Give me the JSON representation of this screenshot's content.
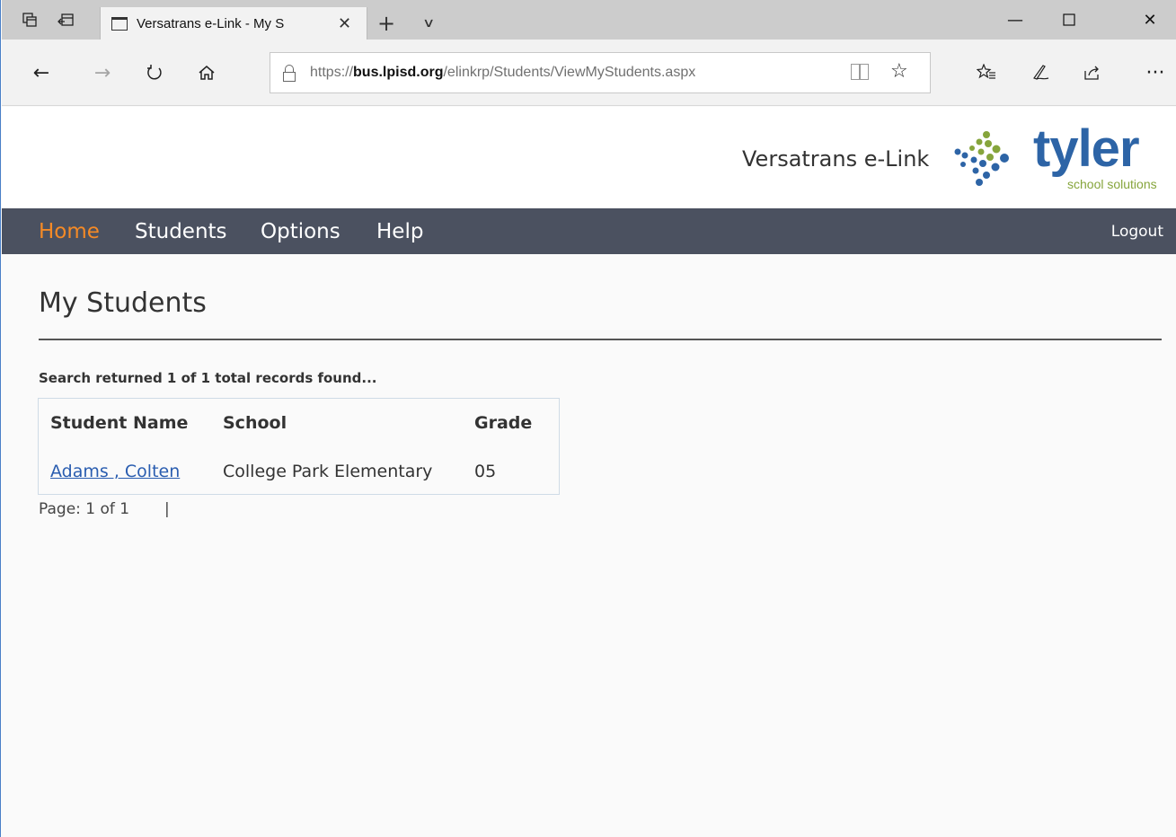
{
  "browser": {
    "tab_title": "Versatrans e-Link - My S",
    "url_prefix": "https://",
    "url_domain": "bus.lpisd.org",
    "url_path": "/elinkrp/Students/ViewMyStudents.aspx"
  },
  "site": {
    "brand": "Versatrans e-Link",
    "logo_text": "tyler",
    "logo_sub": "school solutions",
    "colors": {
      "logo_blue": "#2d64a6",
      "logo_green": "#86a53c",
      "menu_bg": "#4b5160",
      "menu_active": "#f58a26"
    }
  },
  "menu": {
    "items": [
      {
        "label": "Home",
        "active": true
      },
      {
        "label": "Students",
        "active": false
      },
      {
        "label": "Options",
        "active": false
      },
      {
        "label": "Help",
        "active": false
      }
    ],
    "logout": "Logout"
  },
  "main": {
    "title": "My Students",
    "record_info": "Search returned 1 of 1 total records found...",
    "table": {
      "headers": [
        "Student Name",
        "School",
        "Grade"
      ],
      "rows": [
        [
          "Adams , Colten",
          "College Park Elementary",
          "05"
        ]
      ]
    },
    "pager": "Page: 1 of 1",
    "pager_sep": "|"
  },
  "icons": [
    "tab-actions-icon",
    "back-tabs-icon",
    "page-icon",
    "close-icon",
    "new-tab-icon",
    "chevron-down-icon",
    "minimize-icon",
    "maximize-icon",
    "window-close-icon",
    "back-arrow-icon",
    "forward-arrow-icon",
    "refresh-icon",
    "home-icon",
    "lock-icon",
    "reading-view-icon",
    "star-icon",
    "favorites-icon",
    "pen-icon",
    "share-icon",
    "more-icon"
  ]
}
